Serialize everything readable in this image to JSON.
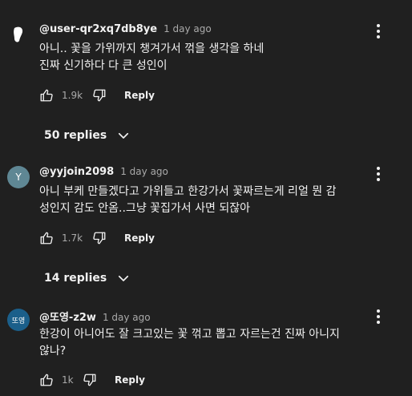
{
  "colors": {
    "background": "#202020",
    "text": "#f1f1f1",
    "muted": "#aaaaaa",
    "avatar2": "#5f8794",
    "avatar3": "#1b5f8a"
  },
  "comments": [
    {
      "author": "@user-qr2xq7db8ye",
      "time": "1 day ago",
      "text": "아니.. 꽃을 가위까지 챙겨가서 꺾을 생각을 하네\n진짜 신기하다 다 큰 성인이",
      "likes": "1.9k",
      "reply_label": "Reply",
      "replies_label": "50 replies",
      "avatar_icon": "white-blob-icon"
    },
    {
      "author": "@yyjoin2098",
      "time": "1 day ago",
      "text": "아니 부케 만들겠다고 가위들고 한강가서 꽃짜르는게 리얼 뭔 감\n성인지 감도 안옴..그냥 꽃집가서 사면 되잖아",
      "likes": "1.7k",
      "reply_label": "Reply",
      "replies_label": "14 replies",
      "avatar_letter": "Y"
    },
    {
      "author": "@또영-z2w",
      "time": "1 day ago",
      "text": "한강이 아니어도 잘 크고있는 꽃 꺾고 뽑고 자르는건 진짜 아니지\n않나?",
      "likes": "1k",
      "reply_label": "Reply",
      "avatar_text": "또영"
    }
  ]
}
